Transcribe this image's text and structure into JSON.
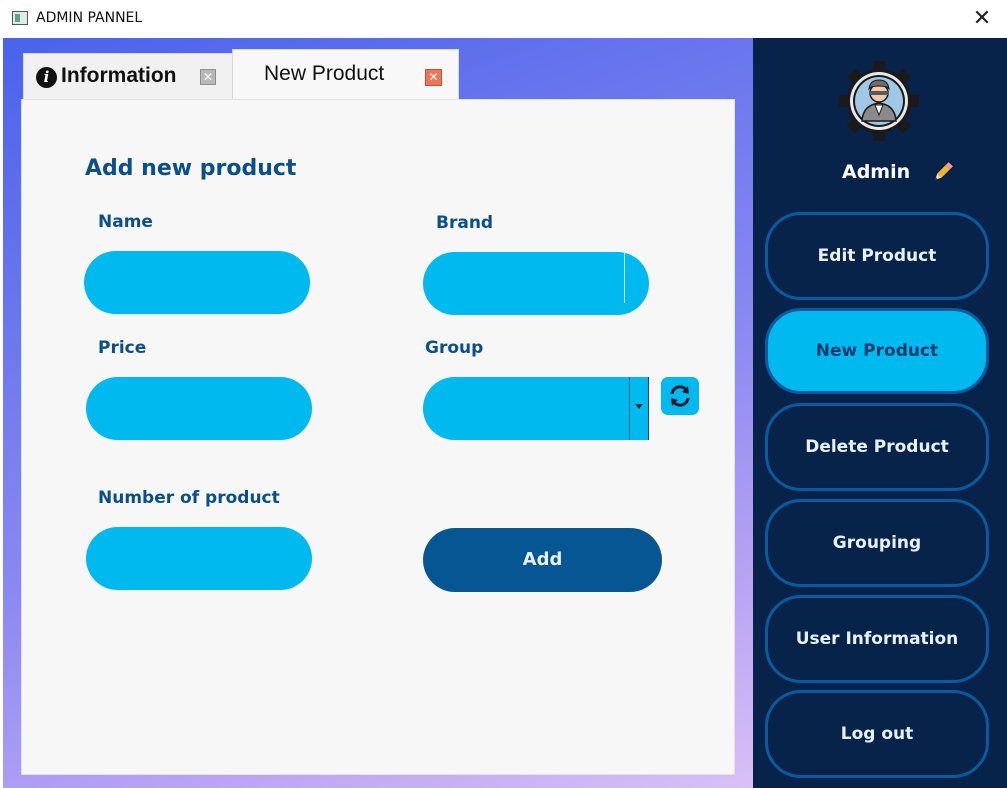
{
  "window": {
    "title": "ADMIN PANNEL",
    "close_glyph": "✕"
  },
  "tabs": [
    {
      "label": "Information",
      "icon": "info-icon",
      "close_glyph": "✕",
      "active": false
    },
    {
      "label": "New Product",
      "close_glyph": "✕",
      "active": true
    }
  ],
  "form": {
    "heading": "Add new product",
    "name_label": "Name",
    "brand_label": "Brand",
    "price_label": "Price",
    "group_label": "Group",
    "number_label": "Number of product",
    "name_value": "",
    "brand_value": "",
    "price_value": "",
    "group_value": "",
    "number_value": "",
    "add_label": "Add",
    "refresh_icon": "refresh-icon"
  },
  "sidebar": {
    "user_name": "Admin",
    "edit_icon": "pencil-icon",
    "items": [
      {
        "label": "Edit Product",
        "active": false
      },
      {
        "label": "New Product",
        "active": true
      },
      {
        "label": "Delete Product",
        "active": false
      },
      {
        "label": "Grouping",
        "active": false
      },
      {
        "label": "User Information",
        "active": false
      },
      {
        "label": "Log out",
        "active": false
      }
    ]
  },
  "colors": {
    "accent": "#00b9ef",
    "primary_dark": "#075694",
    "sidebar_bg": "#07234a",
    "label_text": "#0b4f8a",
    "close_red": "#e9785b"
  }
}
